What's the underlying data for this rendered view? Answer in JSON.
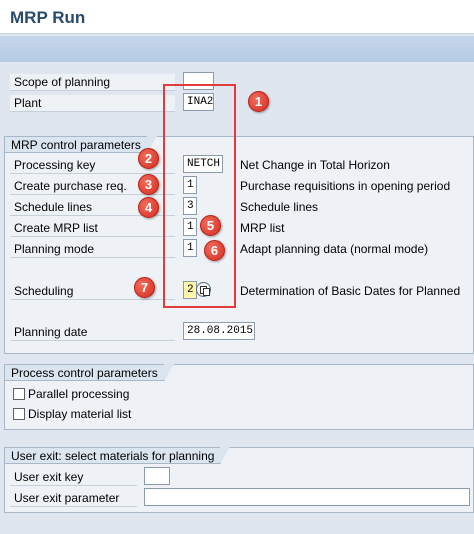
{
  "window": {
    "title": "MRP Run"
  },
  "scope": {
    "scope_label": "Scope of planning",
    "scope_value": "",
    "plant_label": "Plant",
    "plant_value": "INA2"
  },
  "mrp_control": {
    "header": "MRP control parameters",
    "processing_key": {
      "label": "Processing key",
      "value": "NETCH",
      "desc": "Net Change in Total Horizon"
    },
    "create_pr": {
      "label": "Create purchase req.",
      "value": "1",
      "desc": "Purchase requisitions in opening period"
    },
    "schedule_lines": {
      "label": "Schedule lines",
      "value": "3",
      "desc": "Schedule lines"
    },
    "create_mrp_list": {
      "label": "Create MRP list",
      "value": "1",
      "desc": "MRP list"
    },
    "planning_mode": {
      "label": "Planning mode",
      "value": "1",
      "desc": "Adapt planning data (normal mode)"
    },
    "scheduling": {
      "label": "Scheduling",
      "value": "2",
      "desc": "Determination of Basic Dates for Planned"
    },
    "planning_date": {
      "label": "Planning date",
      "value": "28.08.2015"
    }
  },
  "process_control": {
    "header": "Process control parameters",
    "parallel": {
      "label": "Parallel processing",
      "checked": false
    },
    "display_list": {
      "label": "Display material list",
      "checked": false
    }
  },
  "user_exit": {
    "header": "User exit: select materials for planning",
    "key_label": "User exit key",
    "key_value": "",
    "param_label": "User exit parameter",
    "param_value": ""
  },
  "annotations": {
    "highlight_color": "#e03c3c",
    "markers": [
      "1",
      "2",
      "3",
      "4",
      "5",
      "6",
      "7"
    ]
  }
}
